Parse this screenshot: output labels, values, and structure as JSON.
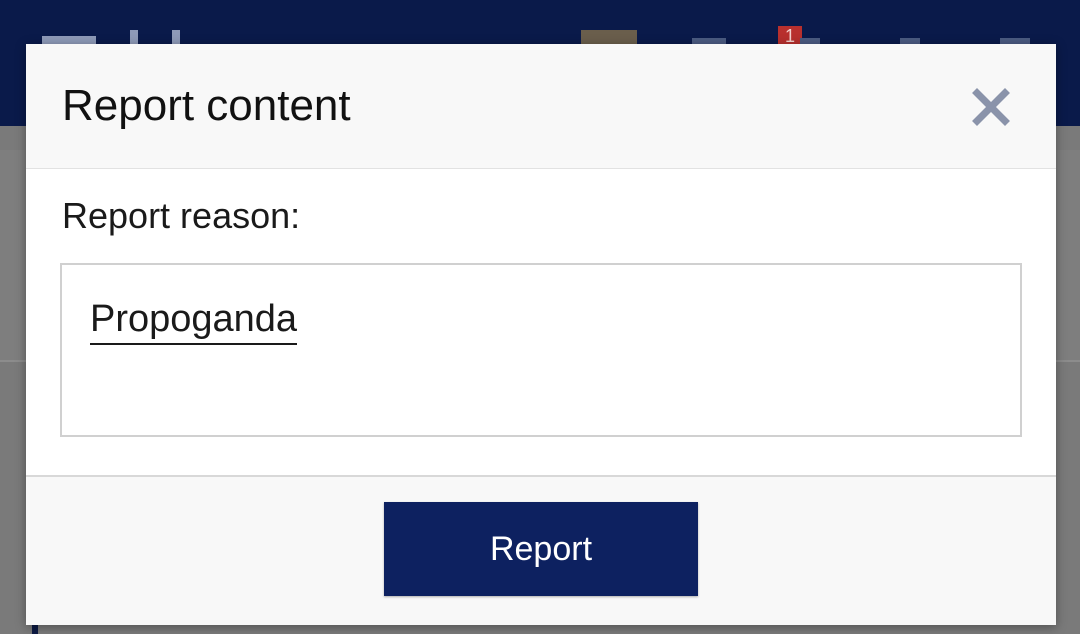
{
  "background": {
    "notification_count": "1",
    "header_color": "#0a1a4a"
  },
  "modal": {
    "title": "Report content",
    "close_icon": "close-icon",
    "reason_label": "Report reason:",
    "reason_value": "Propoganda",
    "submit_label": "Report",
    "accent_color": "#0d2160"
  }
}
